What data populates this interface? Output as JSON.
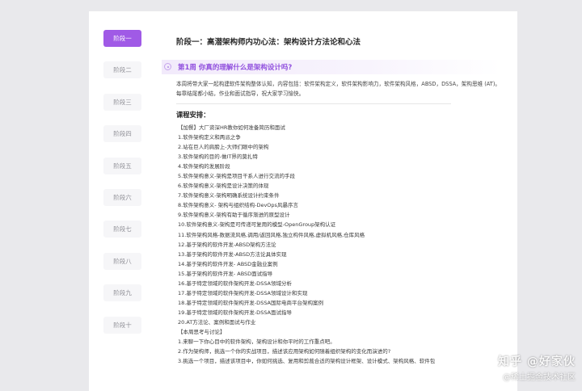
{
  "sidebar": {
    "items": [
      {
        "label": "阶段一",
        "active": true
      },
      {
        "label": "阶段二",
        "active": false
      },
      {
        "label": "阶段三",
        "active": false
      },
      {
        "label": "阶段四",
        "active": false
      },
      {
        "label": "阶段五",
        "active": false
      },
      {
        "label": "阶段六",
        "active": false
      },
      {
        "label": "阶段七",
        "active": false
      },
      {
        "label": "阶段八",
        "active": false
      },
      {
        "label": "阶段九",
        "active": false
      },
      {
        "label": "阶段十",
        "active": false
      }
    ]
  },
  "main": {
    "title": "阶段一：高潜架构师内功心法：架构设计方法论和心法",
    "week": "第1周  你真的理解什么是架构设计吗?",
    "intro": "本周将带大家一起构建软件架构整体认知，内容包括：软件架构定义，软件架构影响力，软件架构风格，ABSD，DSSA，架构思维 (AT)。每章结尾都小结，作业和面试指导，祝大家学习愉快。",
    "arrangement_title": "课程安排：",
    "lessons": [
      "【加餐】大厂资深HR教你如何准备简历和面试",
      "1.软件架构定义和两派之争",
      "2.站在巨人的肩膀上-大师们眼中的架构",
      "3.软件架构的目的-做IT界的莫扎特",
      "4.软件架构的发展阶段",
      "5.软件架构意义-架构是项目干系人进行交流的手段",
      "6.软件架构意义-架构是设计决策的体现",
      "7.软件架构意义-架构明确系统设计约束条件",
      "8.软件架构意义- 架构与组织结构-DevOps风暴序言",
      "9.软件架构意义-架构有助于循序渐进的原型设计",
      "10.软件架构意义-架构是可传递可复用的模型-OpenGroup架构认证",
      "11.软件架构风格-数据流风格,调用/返回风格,独立构件风格,虚拟机风格,仓库风格",
      "12.基于架构的软件开发-ABSD架构方法论",
      "13.基于架构的软件开发-ABSD方法论具体实现",
      "14.基于架构的软件开发- ABSD金融业案例",
      "15.基于架构的软件开发- ABSD面试指导",
      "16.基于特定领域的软件架构开发-DSSA领域分析",
      "17.基于特定领域的软件架构开发-DSSA领域设计和实现",
      "18.基于特定领域的软件架构开发-DSSA国际电商平台架构案例",
      "19.基于特定领域的软件架构开发-DSSA面试指导",
      "20.AT方法论、案例和面试与作业",
      "【本周思考与讨论】",
      "1.来聊一下你心目中的软件架构，架构设计和你平时的工作重点吧。",
      "2.作为架构师，挑选一个你的实战项目，描述该应用架构如何随着组织架构的变化而演进的?",
      "3.挑选一个项目，描述该项目中，你如何挑选、复用和剪裁合适的架构设计框架、设计模式、架构风格、软件包"
    ]
  },
  "watermark": {
    "line1": "知乎 @好家伙",
    "line2": "@稀土掘金技术社区"
  },
  "colors": {
    "accent": "#a05ae6",
    "week_text": "#9150de",
    "background": "#e9e9ec"
  }
}
